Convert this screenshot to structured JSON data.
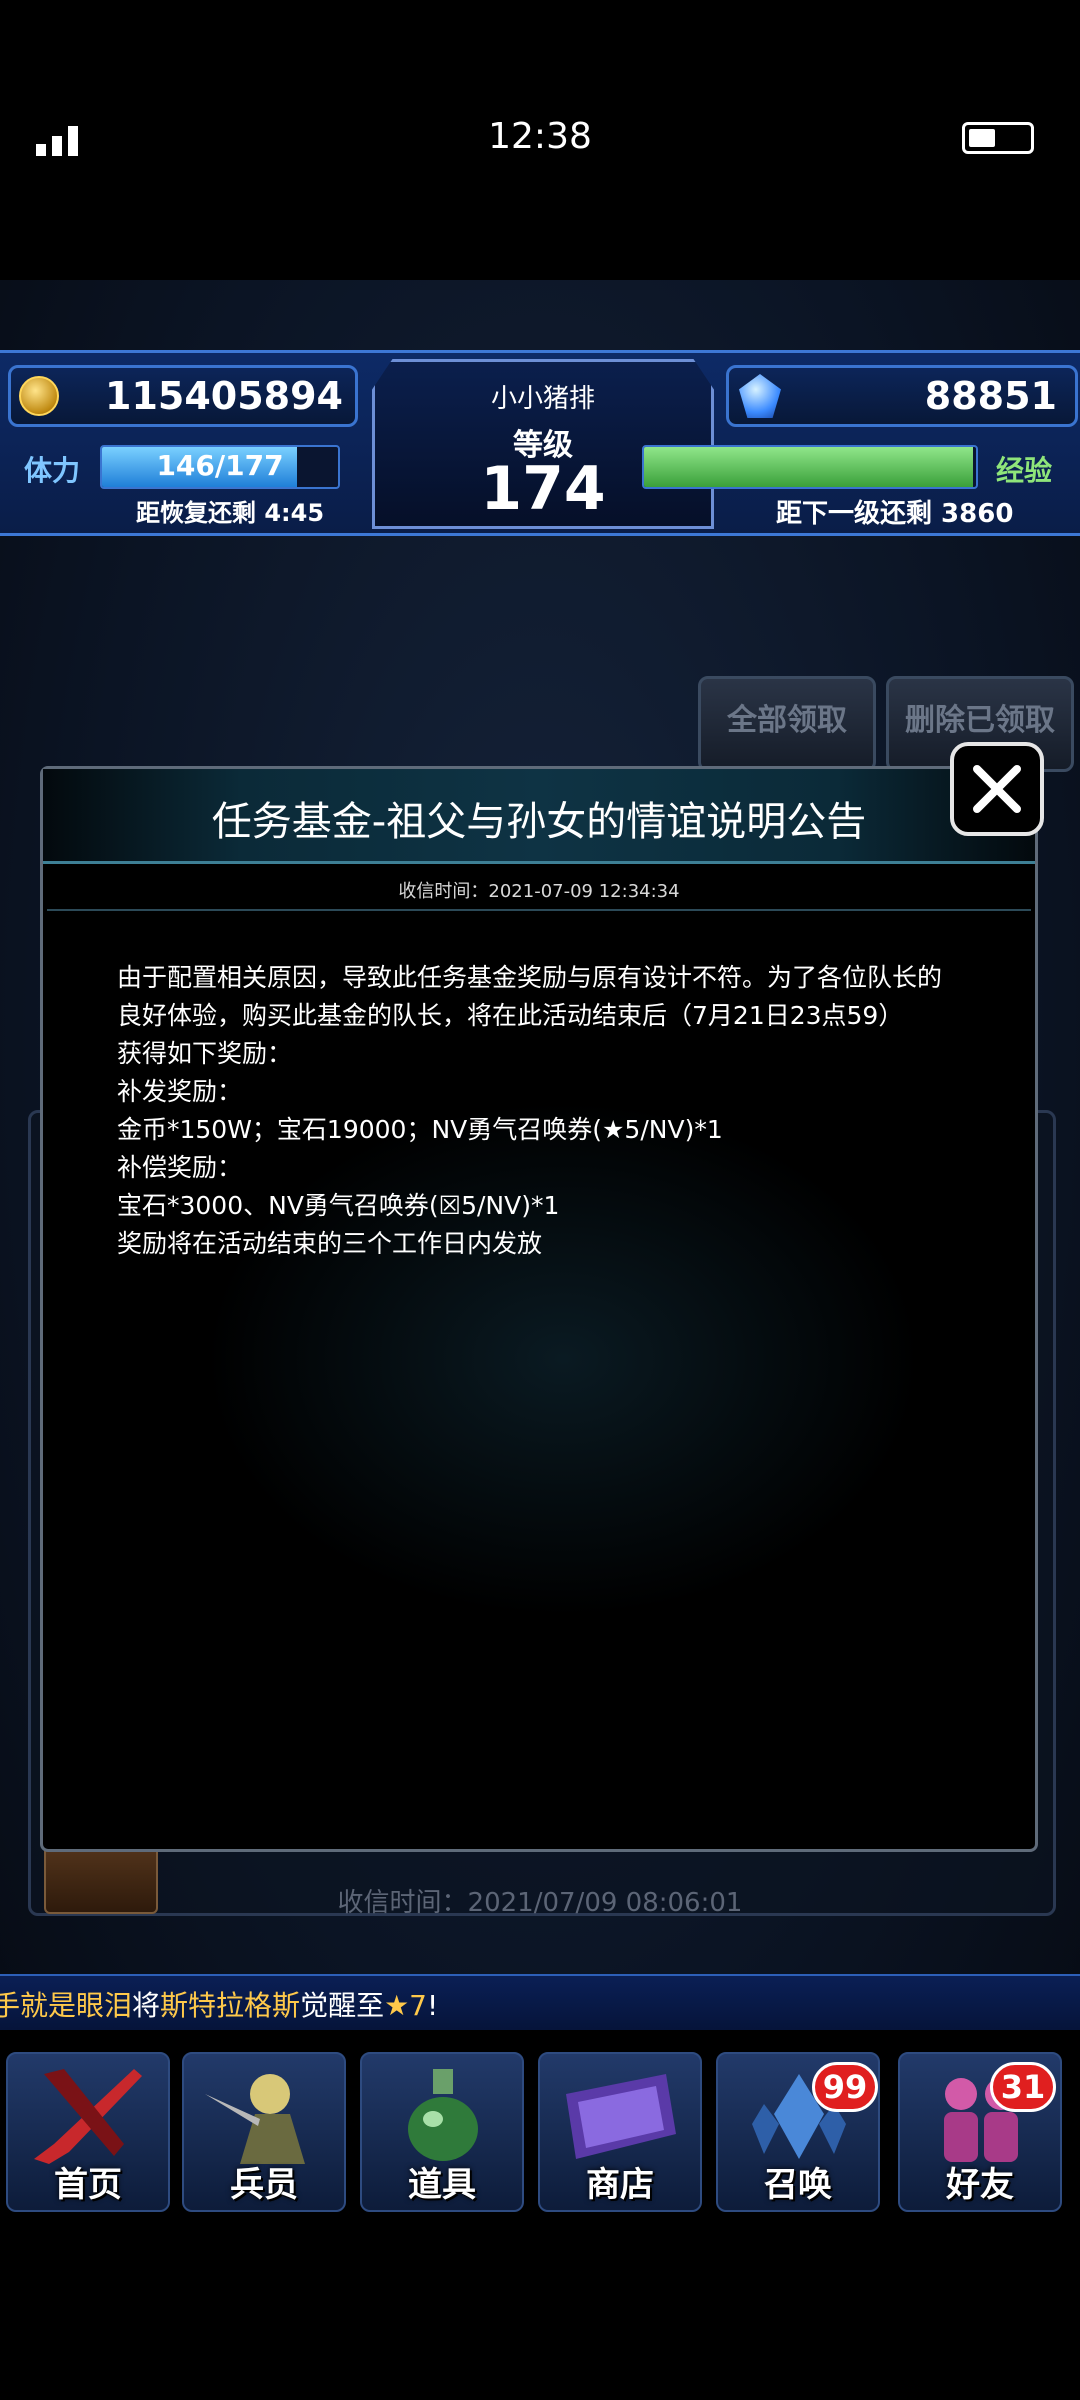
{
  "status_bar": {
    "time": "12:38"
  },
  "hud": {
    "gold": "115405894",
    "gems": "88851",
    "player_name": "小小猪排",
    "level_label": "等级",
    "level": "174",
    "stamina_label": "体力",
    "stamina_text": "146/177",
    "stamina_fraction": 0.825,
    "recover_text": "距恢复还剩 4:45",
    "exp_label": "经验",
    "exp_fraction": 0.99,
    "next_level_text": "距下一级还剩 3860"
  },
  "mailbox": {
    "claim_all_label": "全部领取",
    "delete_claimed_label": "删除已领取",
    "bg_received_time": "收信时间：2021/07/09 08:06:01"
  },
  "dialog": {
    "title": "任务基金-祖父与孙女的情谊说明公告",
    "received_time": "收信时间：2021-07-09 12:34:34",
    "body_lines": [
      "由于配置相关原因，导致此任务基金奖励与原有设计不符。为了各位队长的",
      "良好体验，购买此基金的队长，将在此活动结束后（7月21日23点59）",
      "获得如下奖励：",
      "补发奖励：",
      "金币*150W；宝石19000；NV勇气召唤券(★5/NV)*1",
      "补偿奖励：",
      "宝石*3000、NV勇气召唤券(☒5/NV)*1",
      "奖励将在活动结束的三个工作日内发放"
    ]
  },
  "ticker": {
    "part1": "手就是",
    "part2": "眼泪",
    "part3": "将",
    "part4": "斯特拉格斯",
    "part5": "觉醒至",
    "part6": "★7",
    "part7": "!"
  },
  "nav": {
    "items": [
      {
        "label": "首页",
        "icon": "sword-icon"
      },
      {
        "label": "兵员",
        "icon": "warrior-icon"
      },
      {
        "label": "道具",
        "icon": "potion-icon"
      },
      {
        "label": "商店",
        "icon": "shop-icon"
      },
      {
        "label": "召唤",
        "icon": "crystal-icon",
        "badge": "99"
      },
      {
        "label": "好友",
        "icon": "friends-icon",
        "badge": "31"
      }
    ]
  },
  "colors": {
    "accent_blue": "#3a74d0",
    "stamina": "#1f7fd8",
    "exp": "#3aa03a",
    "badge": "#e01f1f",
    "ticker_highlight": "#ffc94a"
  }
}
